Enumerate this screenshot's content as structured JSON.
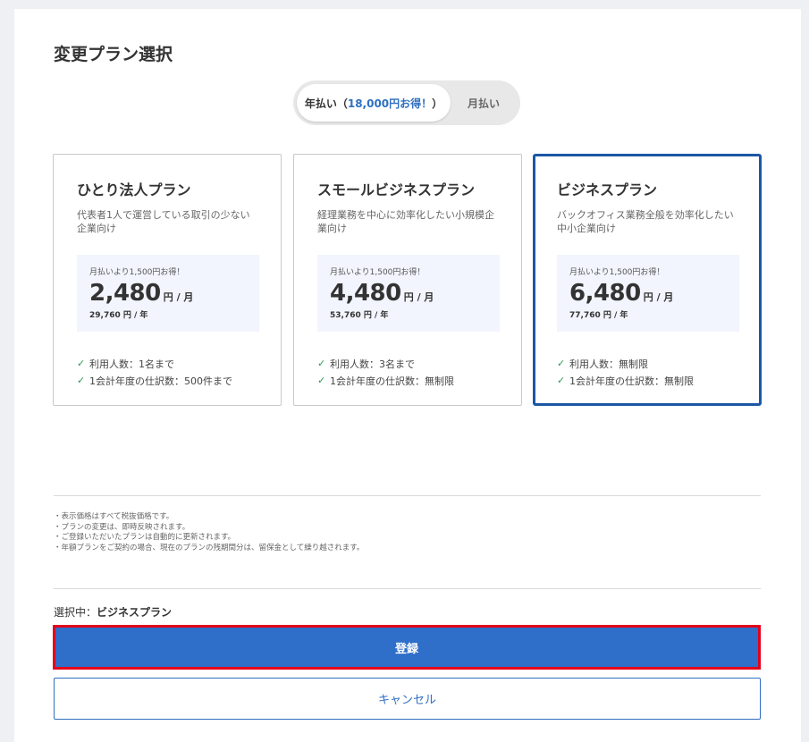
{
  "page": {
    "title": "変更プラン選択"
  },
  "billing_toggle": {
    "yearly_label": "年払い（",
    "yearly_discount": "18,000円お得！",
    "yearly_suffix": "）",
    "monthly_label": "月払い",
    "selected": "yearly"
  },
  "plans": [
    {
      "name": "ひとり法人プラン",
      "description": "代表者1人で運営している取引の少ない企業向け",
      "price_note": "月払いより1,500円お得！",
      "price": "2,480",
      "price_unit": "円 / 月",
      "yearly_price": "29,760 円 / 年",
      "features": [
        "利用人数：1名まで",
        "1会計年度の仕訳数：500件まで"
      ]
    },
    {
      "name": "スモールビジネスプラン",
      "description": "経理業務を中心に効率化したい小規模企業向け",
      "price_note": "月払いより1,500円お得！",
      "price": "4,480",
      "price_unit": "円 / 月",
      "yearly_price": "53,760 円 / 年",
      "features": [
        "利用人数：3名まで",
        "1会計年度の仕訳数：無制限"
      ]
    },
    {
      "name": "ビジネスプラン",
      "description": "バックオフィス業務全般を効率化したい中小企業向け",
      "price_note": "月払いより1,500円お得！",
      "price": "6,480",
      "price_unit": "円 / 月",
      "yearly_price": "77,760 円 / 年",
      "features": [
        "利用人数：無制限",
        "1会計年度の仕訳数：無制限"
      ]
    }
  ],
  "selected_plan_index": 2,
  "check_glyph": "✓",
  "notes": [
    "・表示価格はすべて税抜価格です。",
    "・プランの変更は、即時反映されます。",
    "・ご登録いただいたプランは自動的に更新されます。",
    "・年額プランをご契約の場合、現在のプランの残期間分は、留保金として繰り越されます。"
  ],
  "selection": {
    "label": "選択中：",
    "plan": "ビジネスプラン"
  },
  "actions": {
    "register_label": "登録",
    "cancel_label": "キャンセル"
  },
  "colors": {
    "accent": "#2f6fc9",
    "selected_border": "#1c57a5",
    "highlight_border": "#e3001b",
    "check": "#2e9a4e"
  }
}
